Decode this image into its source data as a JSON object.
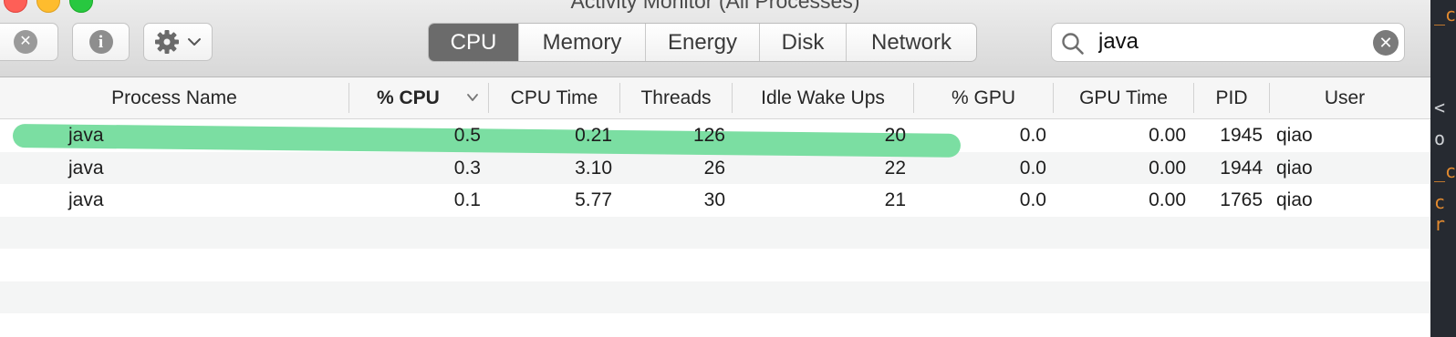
{
  "window": {
    "title": "Activity Monitor (All Processes)"
  },
  "toolbar": {
    "stop_icon": "x-circle-icon",
    "info_icon": "info-circle-icon",
    "gear_icon": "gear-icon",
    "info_glyph": "i",
    "stop_glyph": "✕"
  },
  "tabs": [
    {
      "label": "CPU",
      "active": true
    },
    {
      "label": "Memory",
      "active": false
    },
    {
      "label": "Energy",
      "active": false
    },
    {
      "label": "Disk",
      "active": false
    },
    {
      "label": "Network",
      "active": false
    }
  ],
  "search": {
    "value": "java",
    "clear_glyph": "✕"
  },
  "table": {
    "columns": [
      "Process Name",
      "% CPU",
      "CPU Time",
      "Threads",
      "Idle Wake Ups",
      "% GPU",
      "GPU Time",
      "PID",
      "User"
    ],
    "sort_column": "% CPU",
    "rows": [
      {
        "name": "java",
        "cpu": "0.5",
        "cpu_time": "0.21",
        "threads": "126",
        "idle_wake_ups": "20",
        "gpu": "0.0",
        "gpu_time": "0.00",
        "pid": "1945",
        "user": "qiao"
      },
      {
        "name": "java",
        "cpu": "0.3",
        "cpu_time": "3.10",
        "threads": "26",
        "idle_wake_ups": "22",
        "gpu": "0.0",
        "gpu_time": "0.00",
        "pid": "1944",
        "user": "qiao"
      },
      {
        "name": "java",
        "cpu": "0.1",
        "cpu_time": "5.77",
        "threads": "30",
        "idle_wake_ups": "21",
        "gpu": "0.0",
        "gpu_time": "0.00",
        "pid": "1765",
        "user": "qiao"
      }
    ]
  },
  "highlight_color": "#7bdea2",
  "active_tab_color": "#6b6b6b",
  "sliver": {
    "l1": "<",
    "l2": "o",
    "l3": "_c",
    "l4": "c r"
  }
}
